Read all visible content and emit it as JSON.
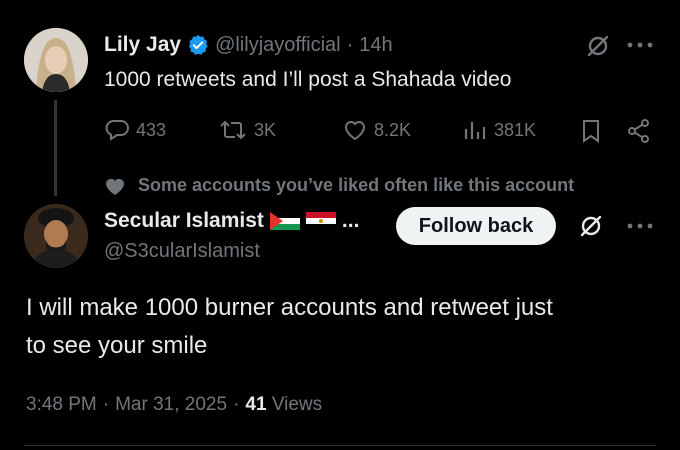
{
  "parent_tweet": {
    "display_name": "Lily Jay",
    "handle": "@lilyjayofficial",
    "separator": "·",
    "time_ago": "14h",
    "text": "1000 retweets and I’ll post a Shahada video",
    "stats": {
      "replies": "433",
      "retweets": "3K",
      "likes": "8.2K",
      "views": "381K"
    }
  },
  "social_context": {
    "text": "Some accounts you’ve liked often like this account"
  },
  "reply_tweet": {
    "display_name": "Secular Islamist",
    "name_ellipsis": "...",
    "handle": "@S3cularIslamist",
    "follow_label": "Follow back",
    "text_line1": "I will make 1000 burner accounts and retweet just",
    "text_line2": "to see your smile",
    "time": "3:48 PM",
    "dot1": "·",
    "date": "Mar 31, 2025",
    "dot2": "·",
    "view_count": "41",
    "views_label": "Views"
  },
  "icons": {
    "verified": "verified-badge-icon",
    "grok": "grok-icon",
    "more": "more-icon",
    "reply": "reply-icon",
    "retweet": "retweet-icon",
    "like": "like-icon",
    "views": "views-icon",
    "bookmark": "bookmark-icon",
    "share": "share-icon",
    "heart_small": "heart-icon"
  },
  "colors": {
    "background": "#000000",
    "text": "#e7e9ea",
    "muted": "#71767b",
    "verified_blue": "#1d9bf0",
    "button_bg": "#eff3f4"
  }
}
